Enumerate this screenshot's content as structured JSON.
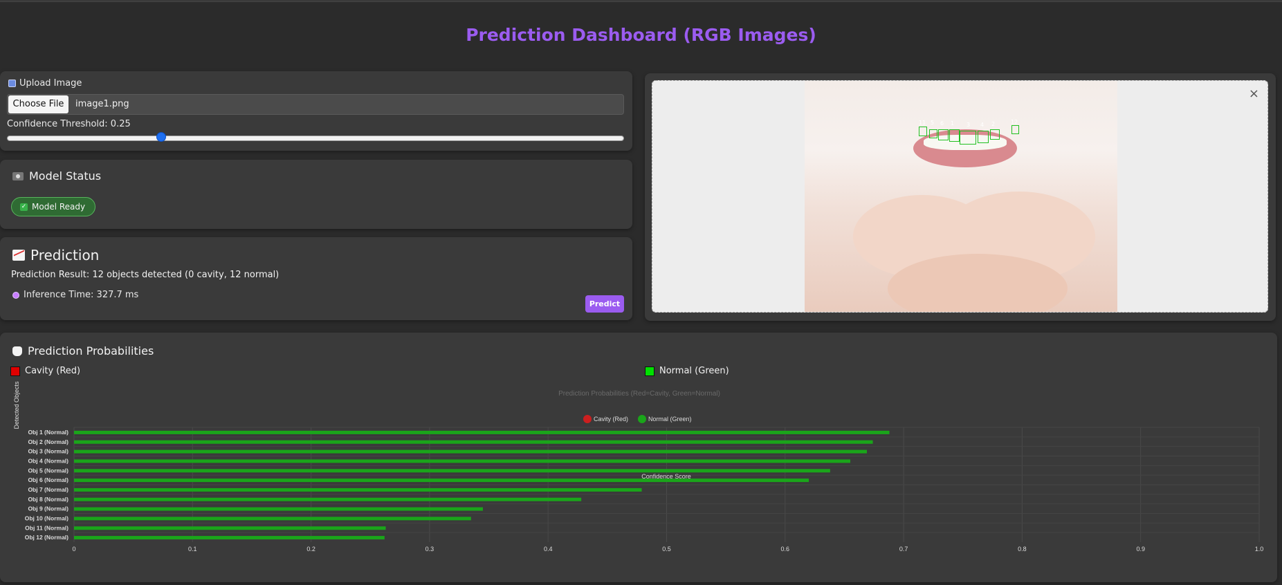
{
  "page": {
    "title": "Prediction Dashboard (RGB Images)"
  },
  "upload": {
    "label": "Upload Image",
    "choose_label": "Choose File",
    "file_name": "image1.png",
    "threshold_label": "Confidence Threshold: 0.25",
    "threshold_value": 0.25
  },
  "model_status": {
    "title": "Model Status",
    "badge": "Model Ready"
  },
  "prediction": {
    "title": "Prediction",
    "result": "Prediction Result: 12 objects detected (0 cavity, 12 normal)",
    "inference": "Inference Time: 327.7 ms",
    "predict_label": "Predict"
  },
  "image_panel": {
    "close_glyph": "×",
    "box_labels": [
      "11",
      "5",
      "6",
      "1",
      "3",
      "4",
      "2",
      "12"
    ]
  },
  "probabilities": {
    "title": "Prediction Probabilities",
    "legend_cavity": "Cavity (Red)",
    "legend_normal": "Normal (Green)"
  },
  "colors": {
    "accent": "#9b5cf0",
    "cavity": "#e00000",
    "normal": "#1aa51a",
    "normal_swatch": "#00e000"
  },
  "chart_data": {
    "type": "bar",
    "orientation": "horizontal",
    "title": "Prediction Probabilities (Red=Cavity, Green=Normal)",
    "xlabel": "Confidence Score",
    "ylabel": "Detected Objects",
    "xlim": [
      0,
      1
    ],
    "xticks": [
      "0",
      "0.1",
      "0.2",
      "0.3",
      "0.4",
      "0.5",
      "0.6",
      "0.7",
      "0.8",
      "0.9",
      "1.0"
    ],
    "legend": [
      "Cavity (Red)",
      "Normal (Green)"
    ],
    "legend_placement": "top-center",
    "grid": true,
    "categories": [
      "Obj 1 (Normal)",
      "Obj 2 (Normal)",
      "Obj 3 (Normal)",
      "Obj 4 (Normal)",
      "Obj 5 (Normal)",
      "Obj 6 (Normal)",
      "Obj 7 (Normal)",
      "Obj 8 (Normal)",
      "Obj 9 (Normal)",
      "Obj 10 (Normal)",
      "Obj 11 (Normal)",
      "Obj 12 (Normal)"
    ],
    "values": [
      0.688,
      0.674,
      0.669,
      0.655,
      0.638,
      0.62,
      0.479,
      0.428,
      0.345,
      0.335,
      0.263,
      0.262
    ]
  }
}
